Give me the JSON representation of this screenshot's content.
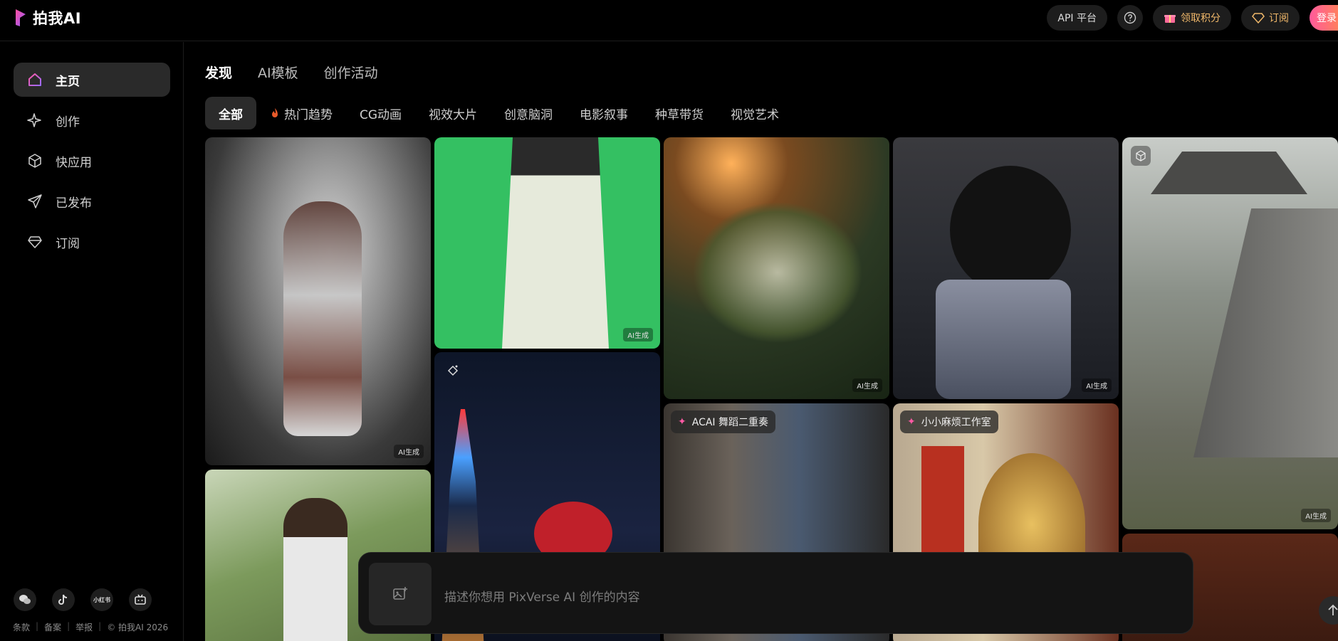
{
  "header": {
    "logo_text": "拍我AI",
    "actions": {
      "api": "API 平台",
      "points": "领取积分",
      "subscribe": "订阅",
      "login": "登录"
    }
  },
  "sidebar": {
    "items": [
      {
        "label": "主页",
        "icon": "home-icon",
        "active": true
      },
      {
        "label": "创作",
        "icon": "sparkle-icon"
      },
      {
        "label": "快应用",
        "icon": "cube-icon"
      },
      {
        "label": "已发布",
        "icon": "send-icon"
      },
      {
        "label": "订阅",
        "icon": "diamond-icon"
      }
    ],
    "social": [
      "wechat-icon",
      "tiktok-icon",
      "xiaohongshu-icon",
      "bilibili-icon"
    ],
    "xiaohongshu_label": "小红书",
    "footer": [
      "条款",
      "备案",
      "举报",
      "© 拍我AI 2026"
    ]
  },
  "main": {
    "tabs": [
      "发现",
      "AI模板",
      "创作活动"
    ],
    "categories": [
      "全部",
      "热门趋势",
      "CG动画",
      "视效大片",
      "创意脑洞",
      "电影叙事",
      "种草带货",
      "视觉艺术"
    ],
    "ai_badge": "AI生成",
    "tags": {
      "card_a": "ACAI 舞蹈二重奏",
      "card_b": "小小麻烦工作室"
    }
  },
  "prompt": {
    "placeholder": "描述你想用 PixVerse AI 创作的内容"
  },
  "colors": {
    "accent_pink": "#ff5a9c",
    "accent_gold": "#f0b86a",
    "background": "#000000"
  }
}
